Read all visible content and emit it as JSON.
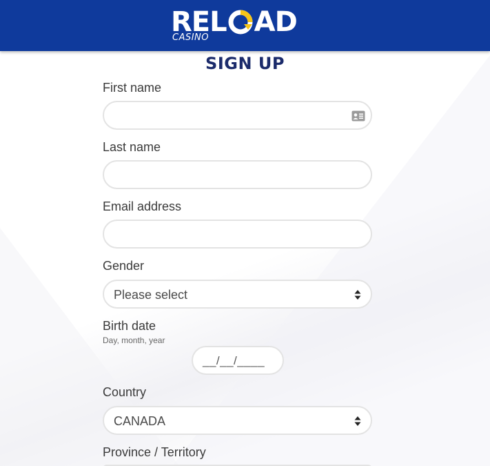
{
  "brand": {
    "logo_word": "RELOAD",
    "logo_sub": "CASINO",
    "colors": {
      "header": "#0f3a9c",
      "accent": "#f5c518",
      "title": "#1b2b6b"
    }
  },
  "form": {
    "title": "SIGN UP",
    "first_name": {
      "label": "First name",
      "value": "",
      "icon": "id-card-icon"
    },
    "last_name": {
      "label": "Last name",
      "value": ""
    },
    "email": {
      "label": "Email address",
      "value": ""
    },
    "gender": {
      "label": "Gender",
      "selected": "Please select"
    },
    "birth_date": {
      "label": "Birth date",
      "hint": "Day, month, year",
      "value": "__/__/____"
    },
    "country": {
      "label": "Country",
      "selected": "CANADA"
    },
    "province": {
      "label": "Province / Territory"
    }
  }
}
